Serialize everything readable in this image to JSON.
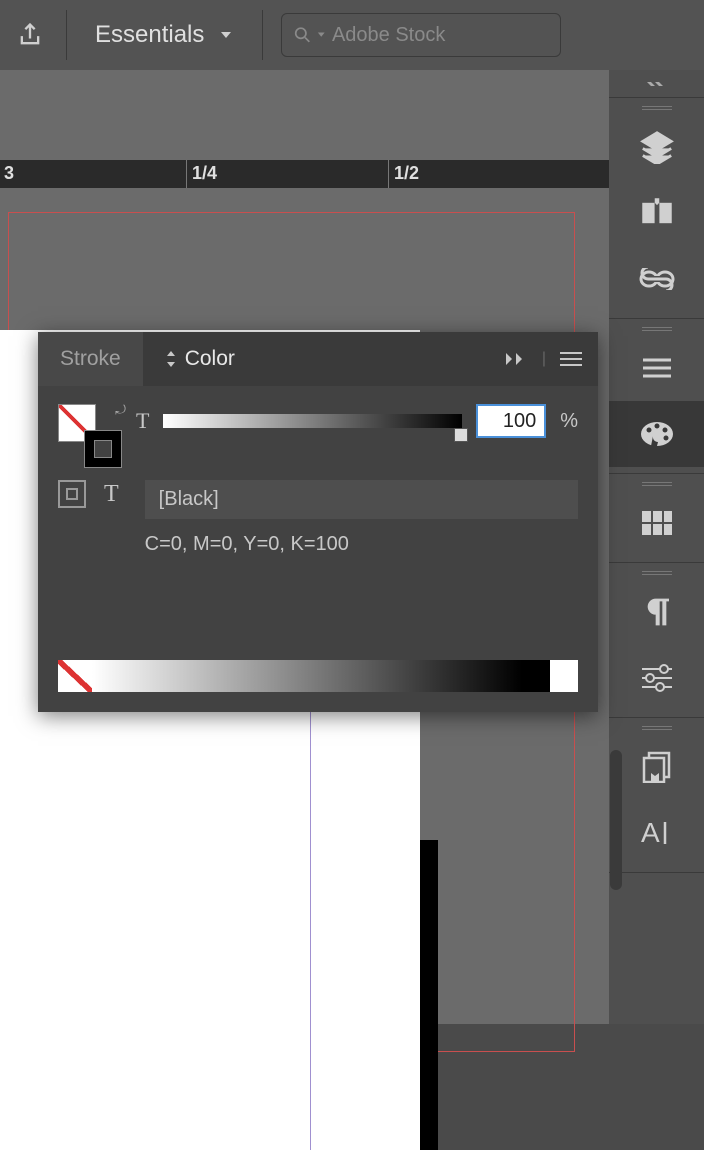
{
  "topbar": {
    "workspace": "Essentials",
    "search_placeholder": "Adobe Stock"
  },
  "ruler": {
    "ticks": [
      {
        "label": "3",
        "pos": 0
      },
      {
        "label": "1/4",
        "pos": 186
      },
      {
        "label": "1/2",
        "pos": 388
      }
    ]
  },
  "color_panel": {
    "tabs": {
      "stroke": "Stroke",
      "color": "Color"
    },
    "tint_label": "T",
    "tint_value": "100",
    "tint_unit": "%",
    "swatch_name": "[Black]",
    "cmyk": "C=0, M=0, Y=0, K=100"
  },
  "side_icons": {
    "layers": "layers-icon",
    "pages": "pages-icon",
    "links": "links-icon",
    "stroke2": "stroke-lines-icon",
    "color": "palette-icon",
    "swatches": "swatches-grid-icon",
    "paragraph": "pilcrow-icon",
    "adjust": "sliders-icon",
    "libraries": "libraries-icon",
    "char": "character-icon"
  }
}
